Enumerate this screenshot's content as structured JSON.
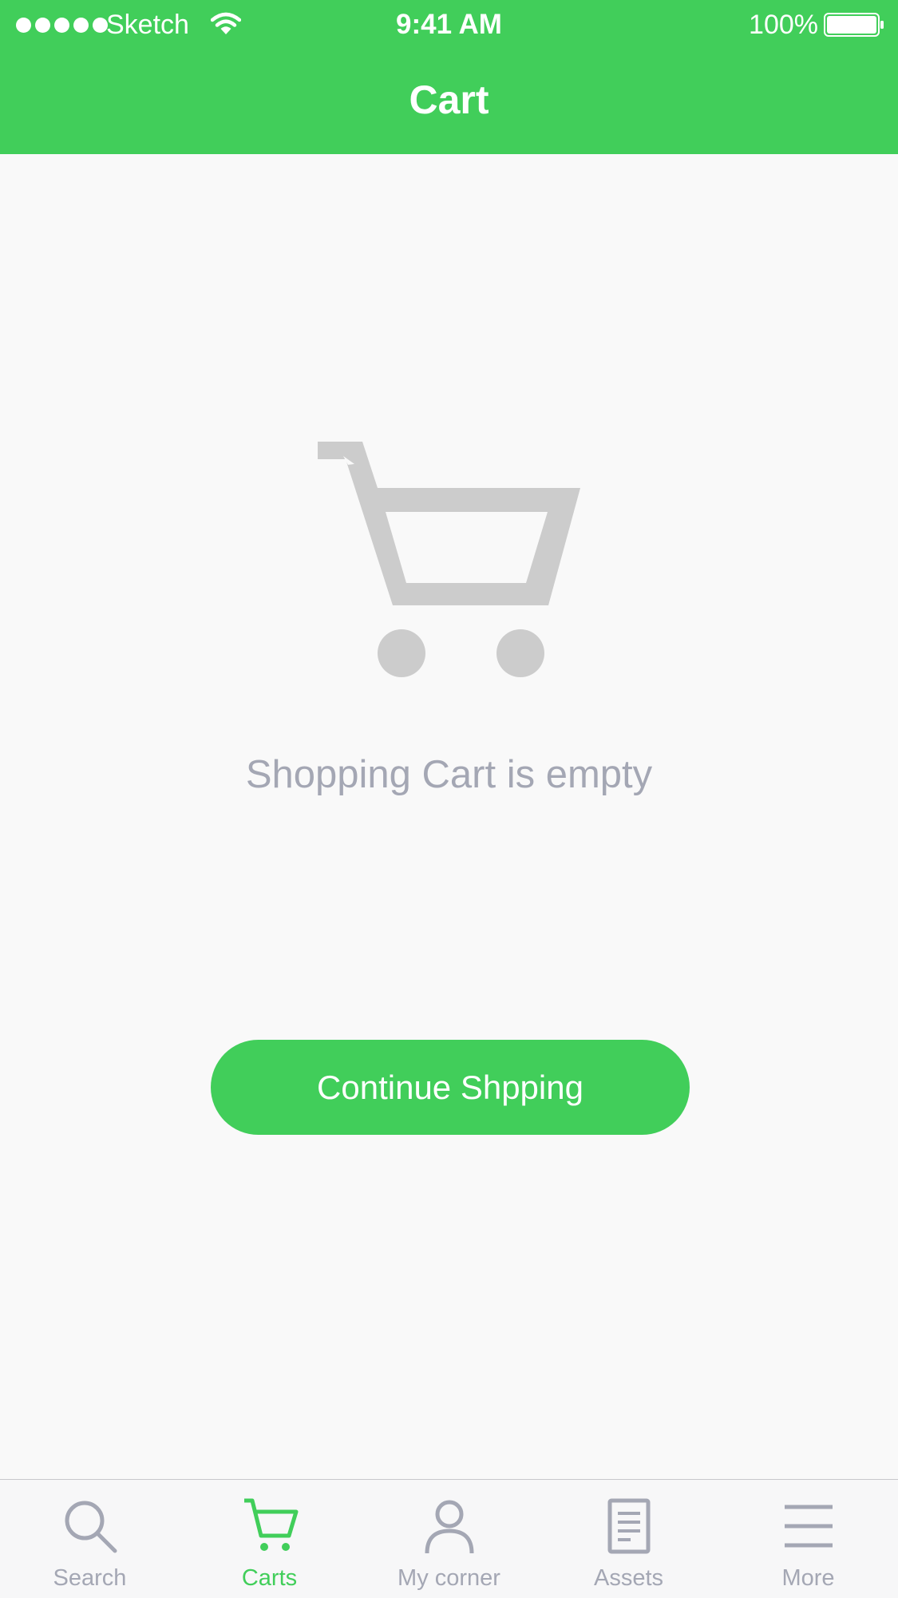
{
  "status_bar": {
    "carrier": "Sketch",
    "time": "9:41 AM",
    "battery": "100%"
  },
  "nav": {
    "title": "Cart"
  },
  "empty_state": {
    "message": "Shopping Cart is empty",
    "icon": "shopping-cart-icon"
  },
  "actions": {
    "continue_label": "Continue Shpping"
  },
  "tabs": [
    {
      "label": "Search",
      "icon": "search-icon",
      "active": false
    },
    {
      "label": "Carts",
      "icon": "cart-icon",
      "active": true
    },
    {
      "label": "My corner",
      "icon": "person-icon",
      "active": false
    },
    {
      "label": "Assets",
      "icon": "document-icon",
      "active": false
    },
    {
      "label": "More",
      "icon": "menu-icon",
      "active": false
    }
  ],
  "colors": {
    "accent": "#41ce5a",
    "background": "#f9f9f9",
    "muted_text": "#a4a7b4",
    "illustration": "#cccccc"
  }
}
